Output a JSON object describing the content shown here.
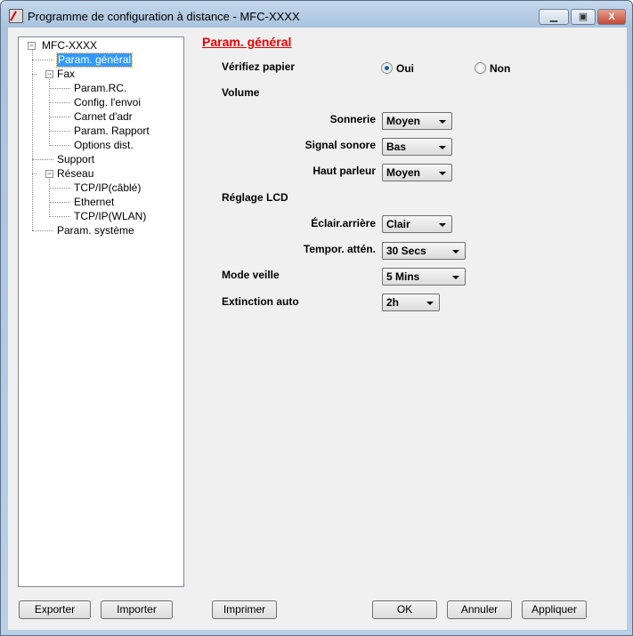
{
  "window": {
    "title": "Programme de configuration à distance - MFC-XXXX",
    "minimize": "▁",
    "maximize": "▣",
    "close": "X"
  },
  "tree": {
    "root": "MFC-XXXX",
    "items": [
      {
        "label": "Param. général",
        "level": 1,
        "selected": true
      },
      {
        "label": "Fax",
        "level": 1,
        "expanded": true
      },
      {
        "label": "Param.RC.",
        "level": 2
      },
      {
        "label": "Config. l'envoi",
        "level": 2
      },
      {
        "label": "Carnet d'adr",
        "level": 2
      },
      {
        "label": "Param. Rapport",
        "level": 2
      },
      {
        "label": "Options dist.",
        "level": 2
      },
      {
        "label": "Support",
        "level": 1
      },
      {
        "label": "Réseau",
        "level": 1,
        "expanded": true
      },
      {
        "label": "TCP/IP(câblé)",
        "level": 2
      },
      {
        "label": "Ethernet",
        "level": 2
      },
      {
        "label": "TCP/IP(WLAN)",
        "level": 2
      },
      {
        "label": "Param. système",
        "level": 1
      }
    ]
  },
  "main": {
    "heading": "Param. général",
    "verify_paper": {
      "label": "Vérifiez papier",
      "oui": "Oui",
      "non": "Non",
      "selected": "Oui"
    },
    "volume": {
      "label": "Volume",
      "sonnerie_label": "Sonnerie",
      "sonnerie": "Moyen",
      "signal_label": "Signal sonore",
      "signal": "Bas",
      "haut_label": "Haut parleur",
      "haut": "Moyen"
    },
    "lcd": {
      "label": "Réglage LCD",
      "eclair_label": "Éclair.arrière",
      "eclair": "Clair",
      "tempor_label": "Tempor. attén.",
      "tempor": "30 Secs"
    },
    "veille": {
      "label": "Mode veille",
      "value": "5 Mins"
    },
    "extinction": {
      "label": "Extinction auto",
      "value": "2h"
    }
  },
  "buttons": {
    "export": "Exporter",
    "import": "Importer",
    "print": "Imprimer",
    "ok": "OK",
    "cancel": "Annuler",
    "apply": "Appliquer"
  },
  "colors": {
    "heading": "#e00000",
    "selection": "#3399ff"
  }
}
